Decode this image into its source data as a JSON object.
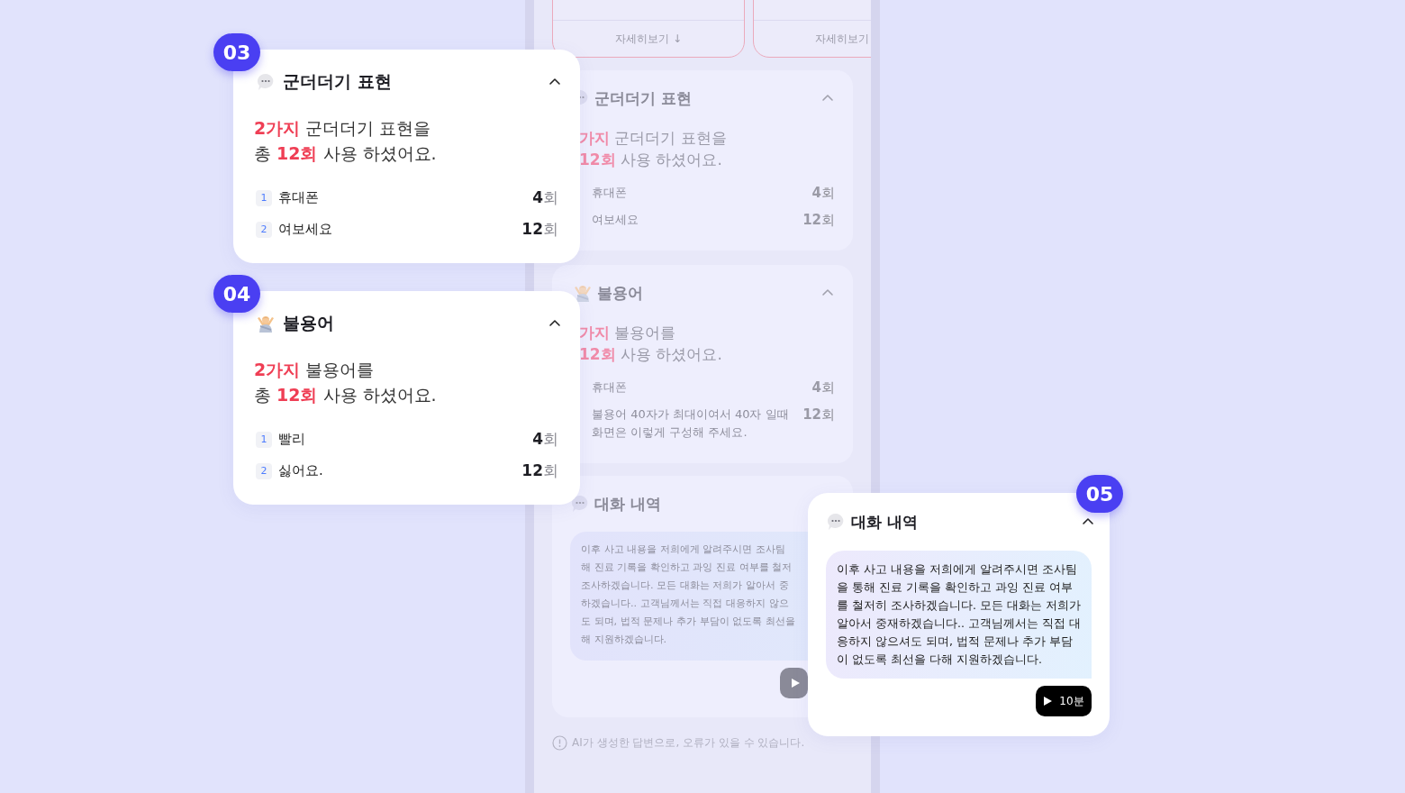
{
  "phone": {
    "preview_cards": [
      {
        "link": "자세히보기 ↓"
      },
      {
        "link": "자세히보기"
      }
    ],
    "sections": [
      {
        "kind": "filler",
        "title": "군더더기 표현",
        "expanded": true,
        "summary": [
          [
            {
              "text": "가지",
              "accent": true
            },
            {
              "text": " 군더더기 표현을",
              "accent": false
            }
          ],
          [
            {
              "text": "12회",
              "accent": true
            },
            {
              "text": " 사용 하셨어요.",
              "accent": false
            }
          ]
        ],
        "items": [
          {
            "label": "휴대폰",
            "count": "4",
            "unit": "회"
          },
          {
            "label": "여보세요",
            "count": "12",
            "unit": "회"
          }
        ]
      },
      {
        "kind": "banned",
        "title": "불용어",
        "expanded": true,
        "summary": [
          [
            {
              "text": "가지",
              "accent": true
            },
            {
              "text": " 불용어를",
              "accent": false
            }
          ],
          [
            {
              "text": "12회",
              "accent": true
            },
            {
              "text": " 사용 하셨어요.",
              "accent": false
            }
          ]
        ],
        "items": [
          {
            "label": "휴대폰",
            "count": "4",
            "unit": "회"
          },
          {
            "label": "불용어 40자가 최대이여서 40자 일때 화면은 이렇게 구성해 주세요.",
            "count": "12",
            "unit": "회"
          }
        ]
      },
      {
        "kind": "chat",
        "title": "대화 내역",
        "lines": [
          "이후 사고 내용을 저희에게 알려주시면 조사팀",
          "해 진료 기록을 확인하고 과잉 진료 여부를 철저",
          "조사하겠습니다. 모든 대화는 저희가 알아서 중",
          "하겠습니다.. 고객님께서는 직접 대응하지 않으",
          "도 되며, 법적 문제나 추가 부담이 없도록 최선을",
          "해 지원하겠습니다."
        ]
      }
    ],
    "footer": "AI가 생성한 답변으로, 오류가 있을 수 있습니다."
  },
  "callouts": [
    {
      "number": "03",
      "kind": "filler",
      "title": "군더더기 표현",
      "expanded": true,
      "summary": [
        [
          {
            "text": "2가지",
            "accent": true
          },
          {
            "text": " 군더더기 표현을",
            "accent": false
          }
        ],
        [
          {
            "text": "총 ",
            "accent": false
          },
          {
            "text": "12회",
            "accent": true
          },
          {
            "text": " 사용 하셨어요.",
            "accent": false
          }
        ]
      ],
      "items": [
        {
          "rank": "1",
          "label": "휴대폰",
          "count": "4",
          "unit": "회"
        },
        {
          "rank": "2",
          "label": "여보세요",
          "count": "12",
          "unit": "회"
        }
      ]
    },
    {
      "number": "04",
      "kind": "banned",
      "title": "불용어",
      "expanded": true,
      "summary": [
        [
          {
            "text": "2가지",
            "accent": true
          },
          {
            "text": " 불용어를",
            "accent": false
          }
        ],
        [
          {
            "text": "총 ",
            "accent": false
          },
          {
            "text": "12회",
            "accent": true
          },
          {
            "text": " 사용 하셨어요.",
            "accent": false
          }
        ]
      ],
      "items": [
        {
          "rank": "1",
          "label": "빨리",
          "count": "4",
          "unit": "회"
        },
        {
          "rank": "2",
          "label": "싫어요.",
          "count": "12",
          "unit": "회"
        }
      ]
    },
    {
      "number": "05",
      "kind": "chat",
      "title": "대화 내역",
      "expanded": true,
      "message": "이후 사고 내용을 저희에게 알려주시면 조사팀을 통해 진료 기록을 확인하고 과잉 진료 여부를 철저히 조사하겠습니다. 모든 대화는 저희가 알아서 중재하겠습니다.. 고객님께서는 직접 대응하지 않으셔도 되며, 법적 문제나 추가 부담이 없도록 최선을 다해 지원하겠습니다.",
      "duration": "10분"
    }
  ]
}
